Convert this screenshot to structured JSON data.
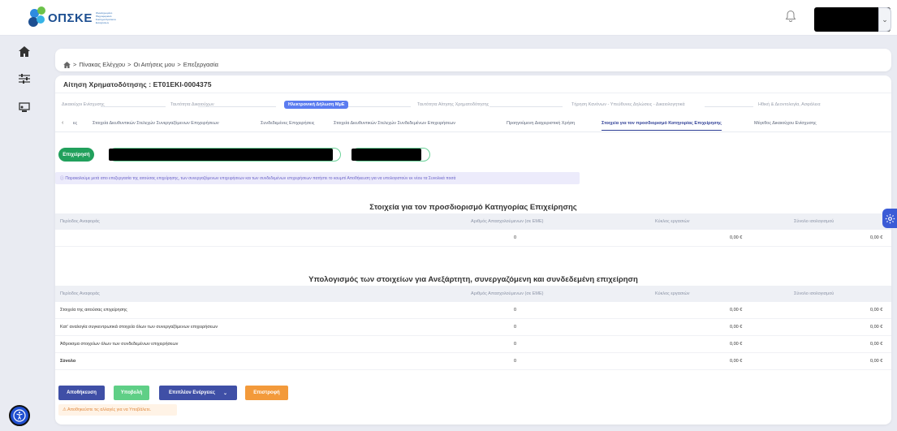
{
  "header": {
    "logo_text": "ΟΠΣΚΕ",
    "logo_tagline": "Ολοκληρωμένο Πληροφοριακό Σύστημα Κρατικών Ενισχύσεων"
  },
  "breadcrumb": {
    "items": [
      "Πίνακας Ελέγχου",
      "Οι Αιτήσεις μου",
      "Επεξεργασία"
    ],
    "separator": ">"
  },
  "application": {
    "title": "Αίτηση Χρηματοδότησης : ΕΤ01ΕΚΙ-0004375"
  },
  "steps": [
    {
      "label": "Δικαιούχοι Ενίσχυσης"
    },
    {
      "label": "Ταυτότητα Δικαιούχων"
    },
    {
      "label": "Ηλεκτρονική Δήλωση ΜμΕ"
    },
    {
      "label": "Ταυτότητα Αίτησης Χρηματοδότησης"
    },
    {
      "label": "Τήρηση Κανόνων - Υπεύθυνες Δηλώσεις - Δικαιολογητικά"
    },
    {
      "label": "Ηθική & Δεοντολογία, Ασφάλεια"
    }
  ],
  "subtabs": [
    {
      "label": "ες"
    },
    {
      "label": "Στοιχεία Διευθυντικών Στελεχών Συνεργαζόμενων Επιχειρήσεων"
    },
    {
      "label": "Συνδεδεμένες Επιχειρήσεις"
    },
    {
      "label": "Στοιχεία Διευθυντικών Στελεχών Συνδεδεμένων Επιχειρήσεων"
    },
    {
      "label": "Προηγούμενη Διαχειριστική Χρήση"
    },
    {
      "label": "Στοιχεία για τον προσδιορισμό Κατηγορίας Επιχείρησης"
    },
    {
      "label": "Μέγεθος Δικαιούχου Ενίσχυσης"
    }
  ],
  "enterprise_button": "Επιχείρησή",
  "info_note": "Παρακαλούμε μετά απο επεξεργασία της αιτούσας επιχείρησης, των συνεργαζόμενων επιχειρήσεων και των συνδεδεμένων επιχειρήσεων πατήστε το κουμπί Αποθήκευση για να υπολογιστούν εκ νέου τα Συνολικά ποσά",
  "section1": {
    "title": "Στοιχεία για τον προσδιορισμό Κατηγορίας Επιχείρησης",
    "columns": [
      "Περίοδος Αναφοράς",
      "Αριθμός Απασχολούμενων (σε ΕΜΕ)",
      "Κύκλος εργασιών",
      "Σύνολο ισολογισμού"
    ],
    "rows": [
      {
        "period": "",
        "employees": "0",
        "turnover": "0,00 €",
        "balance": "0,00 €"
      }
    ]
  },
  "section2": {
    "title": "Υπολογισμός των στοιχείων για Ανεξάρτητη, συνεργαζόμενη και συνδεδεμένη επιχείρηση",
    "columns": [
      "Περίοδος Αναφοράς",
      "Αριθμός Απασχολούμενων (σε ΕΜΕ)",
      "Κύκλος εργασιών",
      "Σύνολο ισολογισμού"
    ],
    "rows": [
      {
        "period": "Στοιχεία της αιτούσας επιχείρησης",
        "employees": "0",
        "turnover": "0,00 €",
        "balance": "0,00 €"
      },
      {
        "period": "Κατ' αναλογία συγκεντρωτικά στοιχεία όλων των συνεργαζόμενων επιχειρήσεων",
        "employees": "0",
        "turnover": "0,00 €",
        "balance": "0,00 €"
      },
      {
        "period": "Άθροισμα στοιχείων όλων των συνδεδεμένων επιχειρήσεων",
        "employees": "0",
        "turnover": "0,00 €",
        "balance": "0,00 €"
      },
      {
        "period": "Σύνολο",
        "employees": "0",
        "turnover": "0,00 €",
        "balance": "0,00 €"
      }
    ]
  },
  "actions": {
    "save": "Αποθήκευση",
    "submit": "Υποβολή",
    "more": "Επιπλέον Ενέργειες",
    "back": "Επιστροφή"
  },
  "warning": "Αποθηκεύστε τις αλλαγές για να Υποβάλετε.",
  "colors": {
    "primary": "#3f4fa6",
    "success": "#21a05c",
    "submit_green": "#5fcf86",
    "orange": "#f39a3b",
    "step_active": "#5b7cf0",
    "accessibility_blue": "#1f4fd1"
  }
}
